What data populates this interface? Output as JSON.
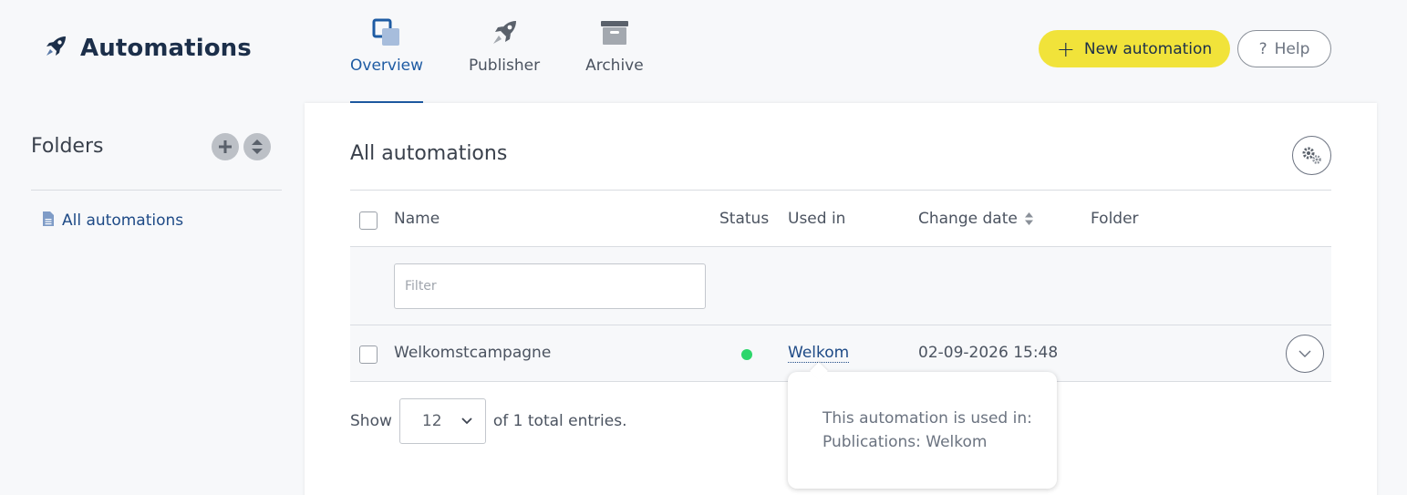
{
  "header": {
    "app_title": "Automations",
    "tabs": [
      {
        "label": "Overview",
        "icon": "overview-icon",
        "active": true
      },
      {
        "label": "Publisher",
        "icon": "rocket-icon",
        "active": false
      },
      {
        "label": "Archive",
        "icon": "archive-box-icon",
        "active": false
      }
    ],
    "new_button_label": "New automation",
    "help_button_label": "Help",
    "accent_color": "#f1e33a",
    "brand_color": "#1e5ba3"
  },
  "sidebar": {
    "title": "Folders",
    "items": [
      {
        "label": "All automations",
        "icon": "document-icon"
      }
    ]
  },
  "main": {
    "title": "All automations",
    "columns": {
      "name": "Name",
      "status": "Status",
      "used_in": "Used in",
      "change_date": "Change date",
      "folder": "Folder"
    },
    "filter_placeholder": "Filter",
    "rows": [
      {
        "name": "Welkomstcampagne",
        "status": "active",
        "status_color": "#2dd66b",
        "used_in": "Welkom",
        "change_date": "02-09-2026 15:48",
        "folder": ""
      }
    ],
    "pager": {
      "show_label": "Show",
      "page_size": "12",
      "total_label": "of 1 total entries."
    }
  },
  "tooltip": {
    "line1": "This automation is used in:",
    "line2": "Publications: Welkom"
  }
}
